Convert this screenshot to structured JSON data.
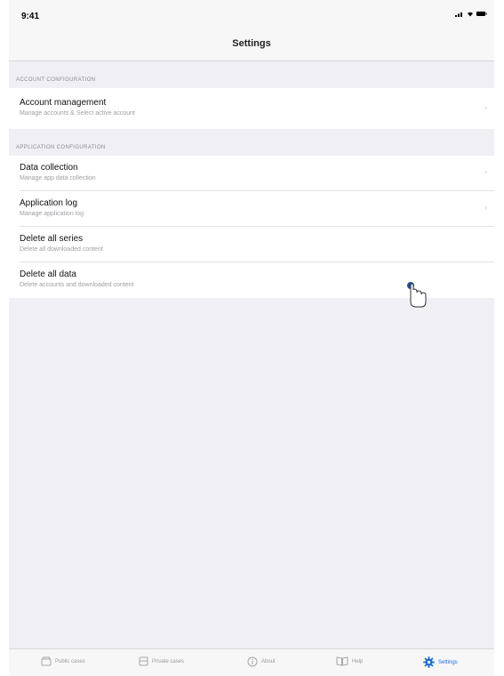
{
  "status": {
    "time": "9:41"
  },
  "nav": {
    "title": "Settings"
  },
  "sections": [
    {
      "header": "ACCOUNT CONFIGURATION"
    },
    {
      "header": "APPLICATION CONFIGURATION"
    }
  ],
  "rows": [
    {
      "label": "Account management",
      "sub": "Manage accounts & Select active account",
      "chevron": "›"
    },
    {
      "label": "Data collection",
      "sub": "Manage app data collection",
      "chevron": "›"
    },
    {
      "label": "Application log",
      "sub": "Manage application log",
      "chevron": "›"
    },
    {
      "label": "Delete all series",
      "sub": "Delete all downloaded content"
    },
    {
      "label": "Delete all data",
      "sub": "Delete accounts and downloaded content"
    }
  ],
  "tabs": [
    {
      "label": "Public cases",
      "icon": "cases-icon"
    },
    {
      "label": "Private cases",
      "icon": "private-cases-icon"
    },
    {
      "label": "About",
      "icon": "info-icon"
    },
    {
      "label": "Help",
      "icon": "book-icon"
    },
    {
      "label": "Settings",
      "icon": "gear-icon",
      "active": true
    }
  ],
  "colors": {
    "accent": "#1e6fd9",
    "background": "#efeff4"
  }
}
